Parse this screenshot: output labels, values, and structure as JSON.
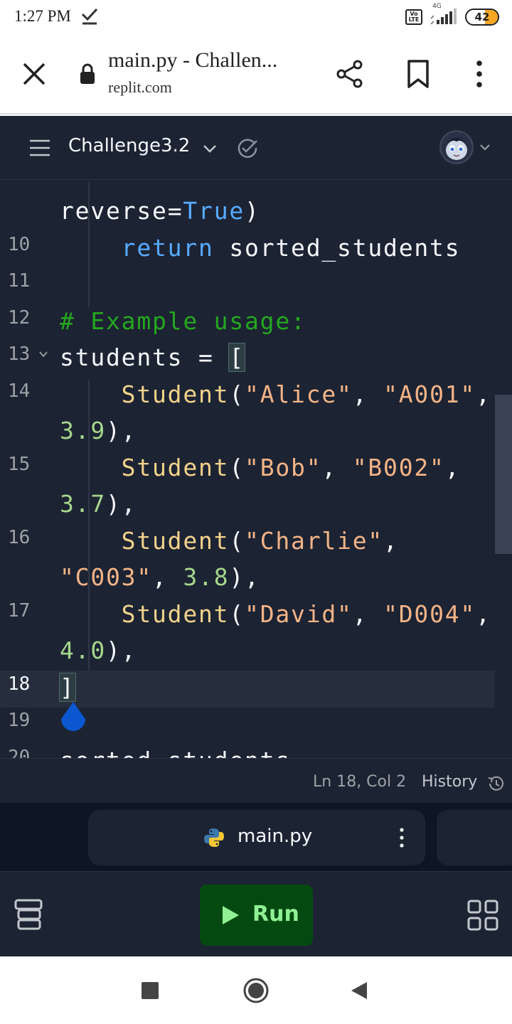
{
  "status_bar": {
    "time": "1:27 PM",
    "network_type": "4G",
    "volte_label": "Vo LTE",
    "battery_level": "42",
    "battery_fraction": 0.42
  },
  "browser": {
    "page_title": "main.py - Challen...",
    "url": "replit.com"
  },
  "header": {
    "repl_name": "Challenge3.2"
  },
  "editor": {
    "lines": [
      {
        "no": "",
        "tokens": [
          {
            "t": "reverse",
            "c": ""
          },
          {
            "t": "=",
            "c": ""
          },
          {
            "t": "True",
            "c": "const"
          },
          {
            "t": ")",
            "c": ""
          }
        ]
      },
      {
        "no": "10",
        "tokens": [
          {
            "t": "    ",
            "c": ""
          },
          {
            "t": "return",
            "c": "kw"
          },
          {
            "t": " sorted_students",
            "c": ""
          }
        ]
      },
      {
        "no": "11",
        "tokens": []
      },
      {
        "no": "12",
        "tokens": [
          {
            "t": "# Example usage:",
            "c": "cm"
          }
        ]
      },
      {
        "no": "13",
        "fold": true,
        "tokens": [
          {
            "t": "students = ",
            "c": ""
          },
          {
            "t": "[",
            "c": "bracket"
          }
        ]
      },
      {
        "no": "14",
        "tokens": [
          {
            "t": "    ",
            "c": ""
          },
          {
            "t": "Student",
            "c": "fn"
          },
          {
            "t": "(",
            "c": ""
          },
          {
            "t": "\"Alice\"",
            "c": "str"
          },
          {
            "t": ", ",
            "c": ""
          },
          {
            "t": "\"A001\"",
            "c": "str"
          },
          {
            "t": ",",
            "c": ""
          }
        ]
      },
      {
        "no": "",
        "tokens": [
          {
            "t": "3.9",
            "c": "num"
          },
          {
            "t": "),",
            "c": ""
          }
        ]
      },
      {
        "no": "15",
        "tokens": [
          {
            "t": "    ",
            "c": ""
          },
          {
            "t": "Student",
            "c": "fn"
          },
          {
            "t": "(",
            "c": ""
          },
          {
            "t": "\"Bob\"",
            "c": "str"
          },
          {
            "t": ", ",
            "c": ""
          },
          {
            "t": "\"B002\"",
            "c": "str"
          },
          {
            "t": ",",
            "c": ""
          }
        ]
      },
      {
        "no": "",
        "tokens": [
          {
            "t": "3.7",
            "c": "num"
          },
          {
            "t": "),",
            "c": ""
          }
        ]
      },
      {
        "no": "16",
        "tokens": [
          {
            "t": "    ",
            "c": ""
          },
          {
            "t": "Student",
            "c": "fn"
          },
          {
            "t": "(",
            "c": ""
          },
          {
            "t": "\"Charlie\"",
            "c": "str"
          },
          {
            "t": ",",
            "c": ""
          }
        ]
      },
      {
        "no": "",
        "tokens": [
          {
            "t": "\"C003\"",
            "c": "str"
          },
          {
            "t": ", ",
            "c": ""
          },
          {
            "t": "3.8",
            "c": "num"
          },
          {
            "t": "),",
            "c": ""
          }
        ]
      },
      {
        "no": "17",
        "tokens": [
          {
            "t": "    ",
            "c": ""
          },
          {
            "t": "Student",
            "c": "fn"
          },
          {
            "t": "(",
            "c": ""
          },
          {
            "t": "\"David\"",
            "c": "str"
          },
          {
            "t": ", ",
            "c": ""
          },
          {
            "t": "\"D004\"",
            "c": "str"
          },
          {
            "t": ",",
            "c": ""
          }
        ]
      },
      {
        "no": "",
        "tokens": [
          {
            "t": "4.0",
            "c": "num"
          },
          {
            "t": "),",
            "c": ""
          }
        ]
      },
      {
        "no": "18",
        "active": true,
        "tokens": [
          {
            "t": "]",
            "c": "bracket"
          }
        ]
      },
      {
        "no": "19",
        "tokens": []
      },
      {
        "no": "20",
        "tokens": [
          {
            "t": "sorted_students =",
            "c": ""
          }
        ]
      }
    ]
  },
  "status_line": {
    "cursor_position": "Ln 18, Col 2",
    "history_label": "History"
  },
  "file_tab": {
    "name": "main.py"
  },
  "toolbar": {
    "run_label": "Run"
  },
  "colors": {
    "editor_bg": "#1c2333",
    "run_button_bg": "#044a10",
    "run_button_text": "#8ff194",
    "keyword": "#57abff",
    "comment": "#24a71f",
    "function": "#f2d38a",
    "string": "#f4b486",
    "number": "#a6d78c",
    "cursor_handle": "#0b57d0"
  },
  "icons": [
    "check-icon",
    "close-icon",
    "lock-icon",
    "share-icon",
    "bookmark-icon",
    "more-vert-icon",
    "hamburger-icon",
    "chevron-down-icon",
    "checkpoint-icon",
    "avatar",
    "history-icon",
    "python-icon",
    "tools-icon",
    "play-icon",
    "grid-icon",
    "nav-recents-icon",
    "nav-home-icon",
    "nav-back-icon"
  ]
}
